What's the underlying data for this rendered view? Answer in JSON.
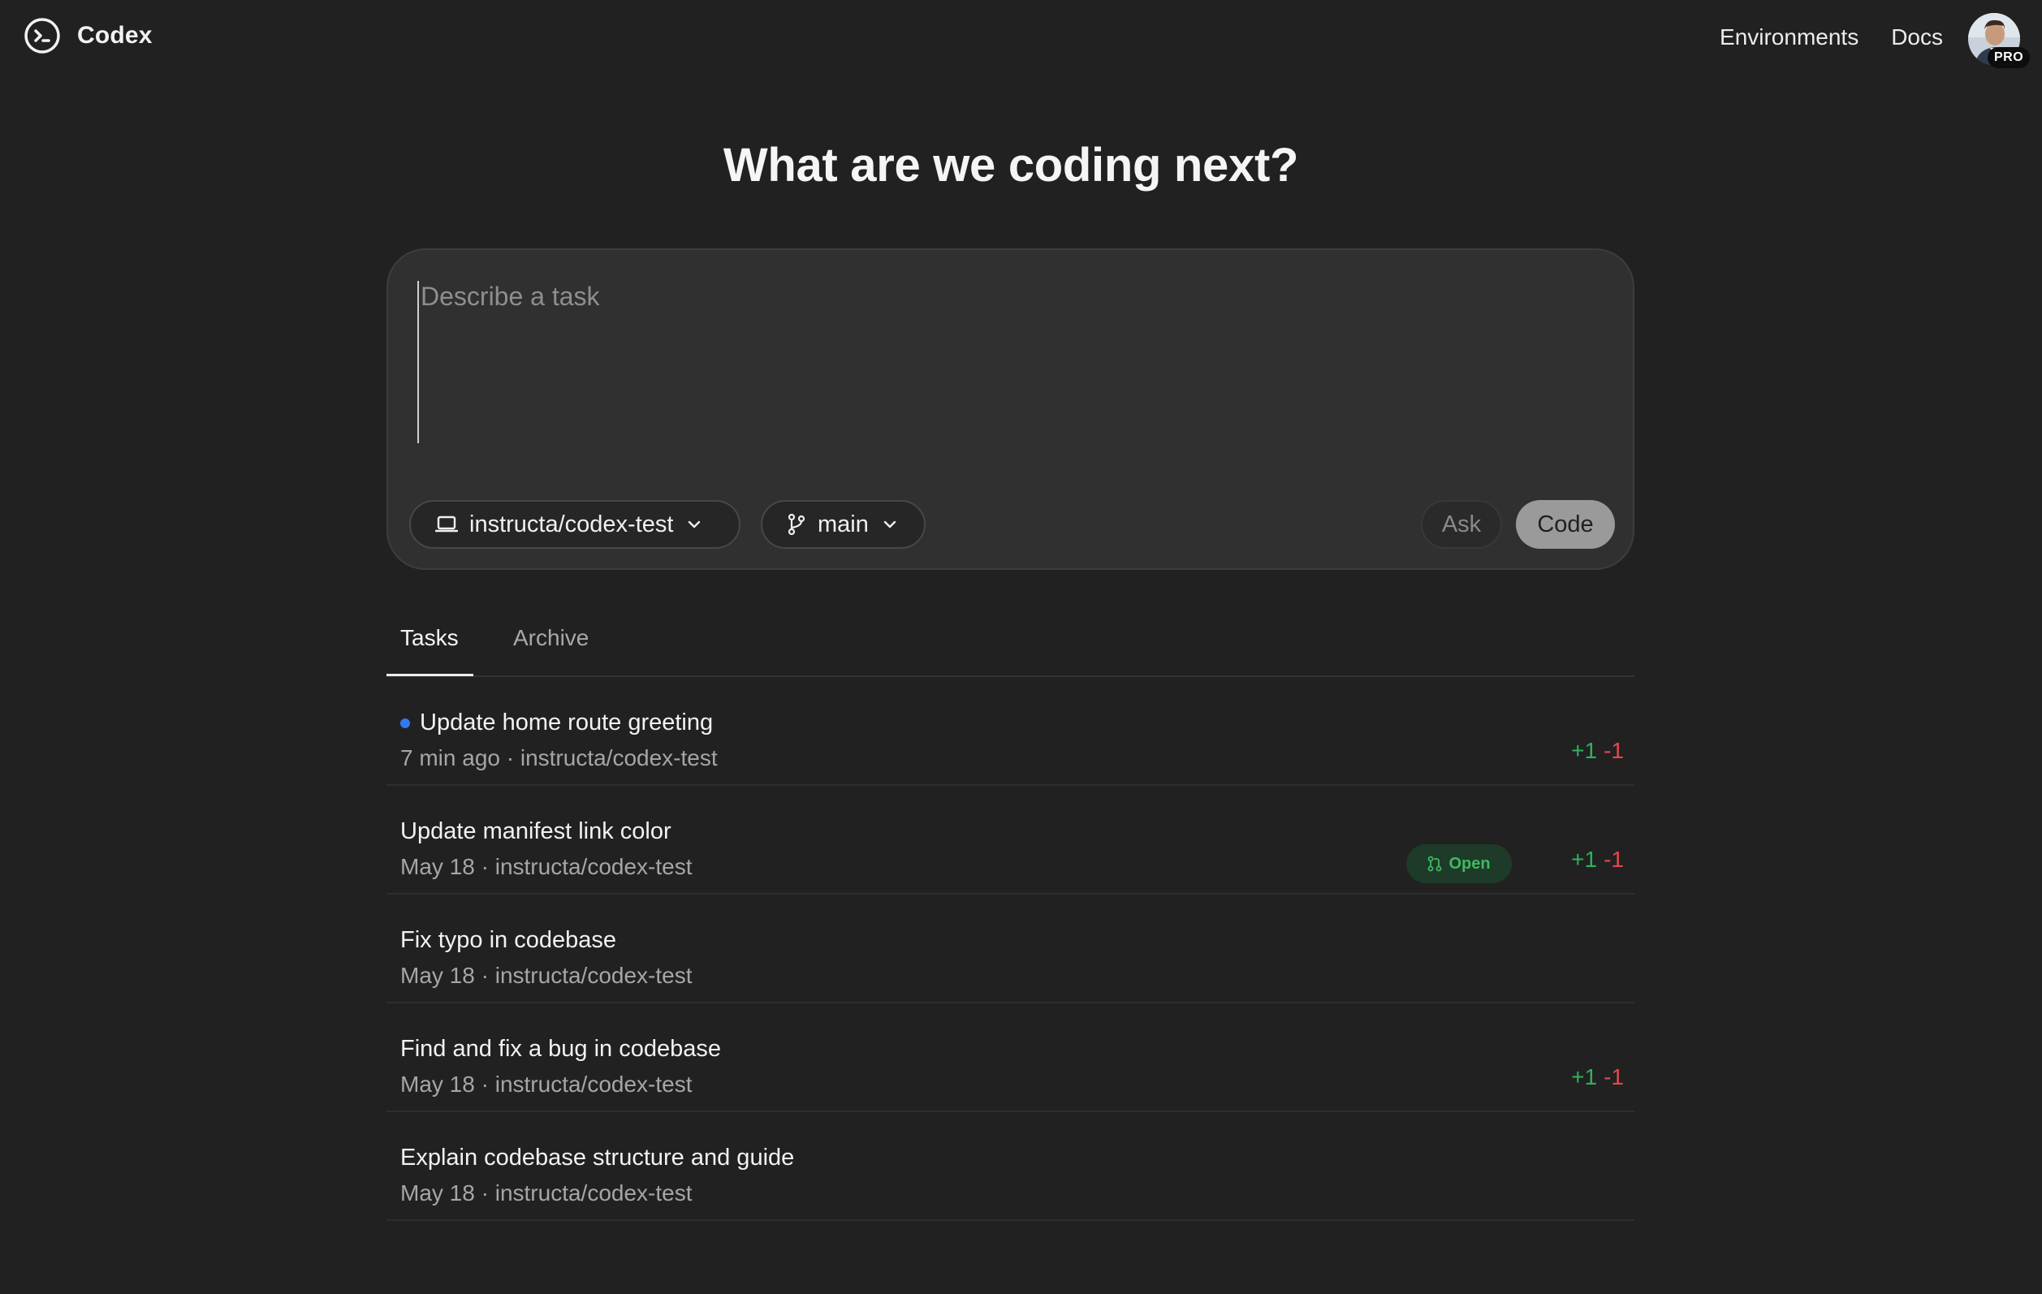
{
  "app": {
    "name": "Codex"
  },
  "nav": {
    "environments": "Environments",
    "docs": "Docs",
    "plan_badge": "PRO"
  },
  "heading": "What are we coding next?",
  "composer": {
    "placeholder": "Describe a task",
    "repo": "instructa/codex-test",
    "branch": "main",
    "ask_label": "Ask",
    "code_label": "Code"
  },
  "tabs": {
    "tasks": "Tasks",
    "archive": "Archive",
    "active": "Tasks"
  },
  "tasks": [
    {
      "title": "Update home route greeting",
      "time": "7 min ago",
      "repo": "instructa/codex-test",
      "unread": true,
      "additions": "+1",
      "deletions": "-1",
      "status": ""
    },
    {
      "title": "Update manifest link color",
      "time": "May 18",
      "repo": "instructa/codex-test",
      "unread": false,
      "additions": "+1",
      "deletions": "-1",
      "status": "Open"
    },
    {
      "title": "Fix typo in codebase",
      "time": "May 18",
      "repo": "instructa/codex-test",
      "unread": false,
      "additions": "",
      "deletions": "",
      "status": ""
    },
    {
      "title": "Find and fix a bug in codebase",
      "time": "May 18",
      "repo": "instructa/codex-test",
      "unread": false,
      "additions": "+1",
      "deletions": "-1",
      "status": ""
    },
    {
      "title": "Explain codebase structure and guide",
      "time": "May 18",
      "repo": "instructa/codex-test",
      "unread": false,
      "additions": "",
      "deletions": "",
      "status": ""
    }
  ],
  "meta_separator": " · ",
  "colors": {
    "background": "#212121",
    "composer": "#303030",
    "additions": "#2fb25a",
    "deletions": "#e5484d",
    "unread_dot": "#2f7bf0",
    "open_badge_text": "#3fb95f"
  },
  "icons": {
    "logo": "terminal-circle-icon",
    "repo": "laptop-icon",
    "branch": "git-branch-icon",
    "chevron": "chevron-down-icon",
    "pr": "pull-request-icon"
  }
}
